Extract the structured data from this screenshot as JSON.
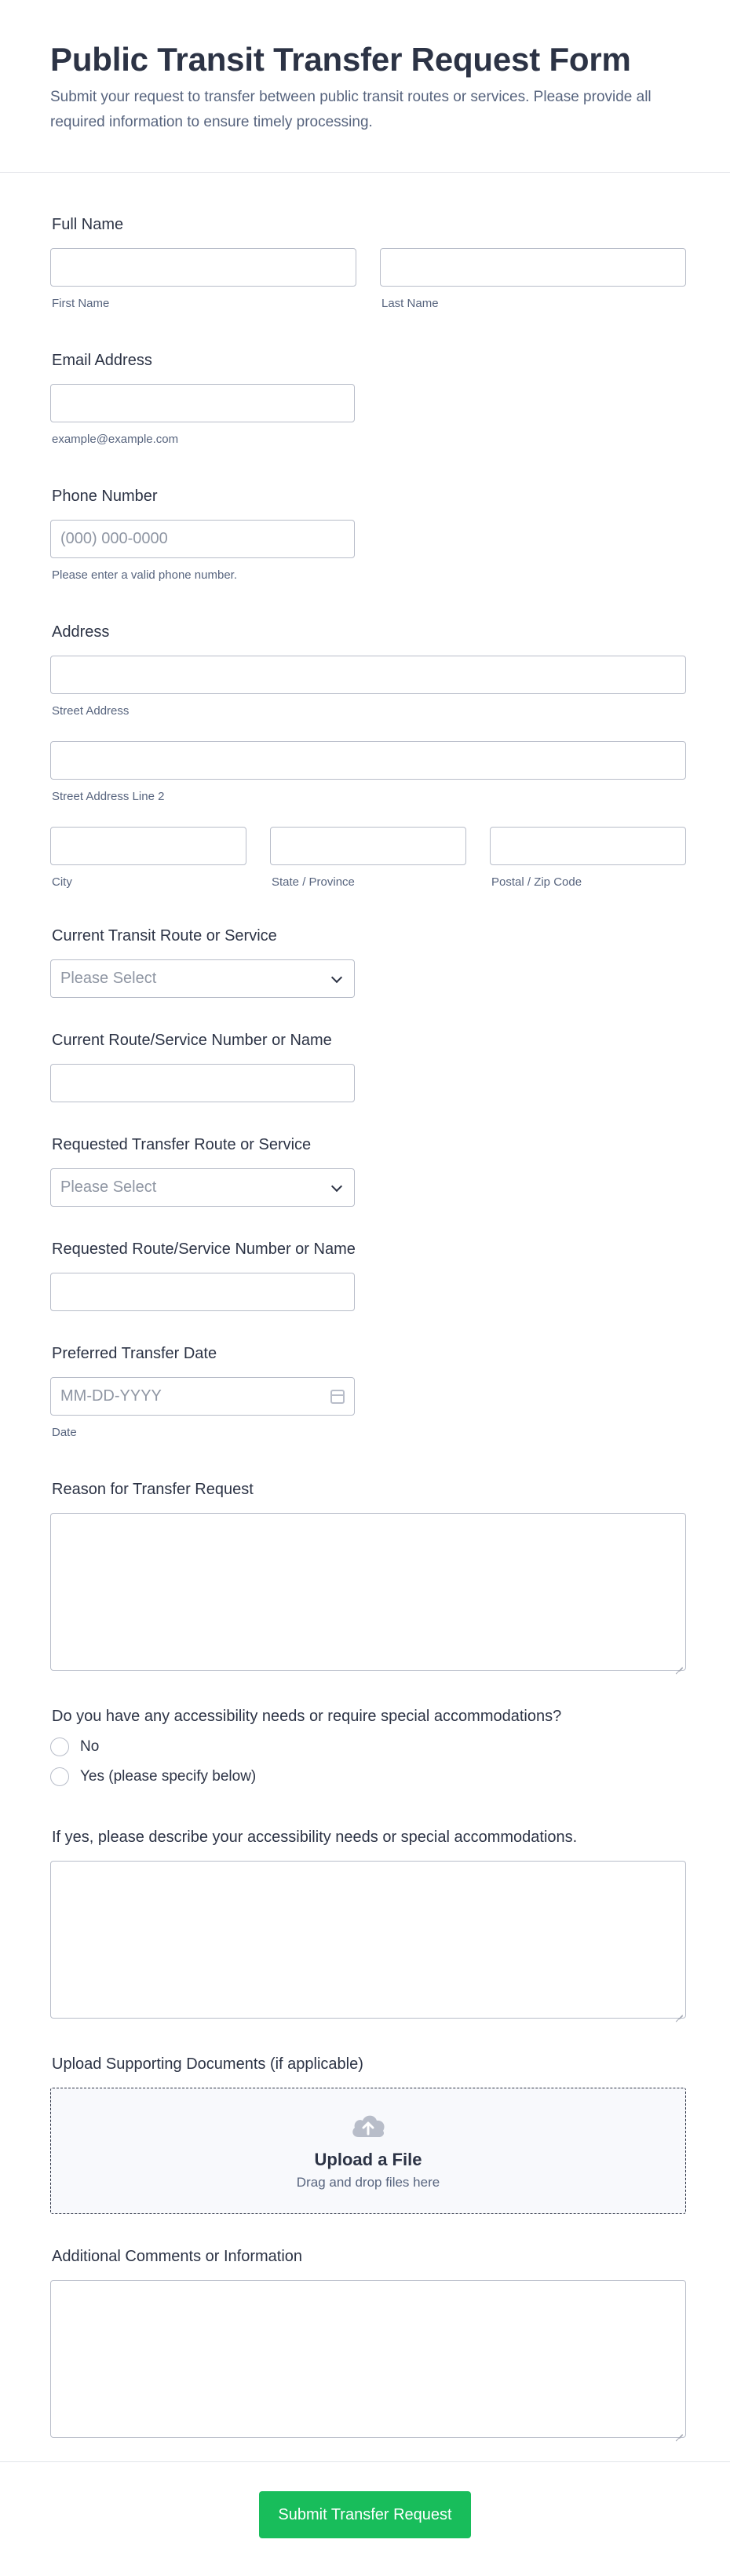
{
  "header": {
    "title": "Public Transit Transfer Request Form",
    "description": "Submit your request to transfer between public transit routes or services. Please provide all required information to ensure timely processing."
  },
  "full_name": {
    "label": "Full Name",
    "first_sub": "First Name",
    "last_sub": "Last Name"
  },
  "email": {
    "label": "Email Address",
    "sub": "example@example.com"
  },
  "phone": {
    "label": "Phone Number",
    "placeholder": "(000) 000-0000",
    "sub": "Please enter a valid phone number."
  },
  "address": {
    "label": "Address",
    "street_sub": "Street Address",
    "street2_sub": "Street Address Line 2",
    "city_sub": "City",
    "state_sub": "State / Province",
    "zip_sub": "Postal / Zip Code"
  },
  "current_route": {
    "label": "Current Transit Route or Service",
    "placeholder": "Please Select"
  },
  "current_number": {
    "label": "Current Route/Service Number or Name"
  },
  "requested_route": {
    "label": "Requested Transfer Route or Service",
    "placeholder": "Please Select"
  },
  "requested_number": {
    "label": "Requested Route/Service Number or Name"
  },
  "transfer_date": {
    "label": "Preferred Transfer Date",
    "placeholder": "MM-DD-YYYY",
    "sub": "Date"
  },
  "reason": {
    "label": "Reason for Transfer Request"
  },
  "accessibility": {
    "label": "Do you have any accessibility needs or require special accommodations?",
    "options": [
      "No",
      "Yes (please specify below)"
    ]
  },
  "accessibility_details": {
    "label": "If yes, please describe your accessibility needs or special accommodations."
  },
  "upload": {
    "label": "Upload Supporting Documents (if applicable)",
    "title": "Upload a File",
    "subtitle": "Drag and drop files here",
    "icon": "cloud-upload-icon"
  },
  "comments": {
    "label": "Additional Comments or Information"
  },
  "submit": {
    "label": "Submit Transfer Request",
    "color": "#18bd5b"
  }
}
